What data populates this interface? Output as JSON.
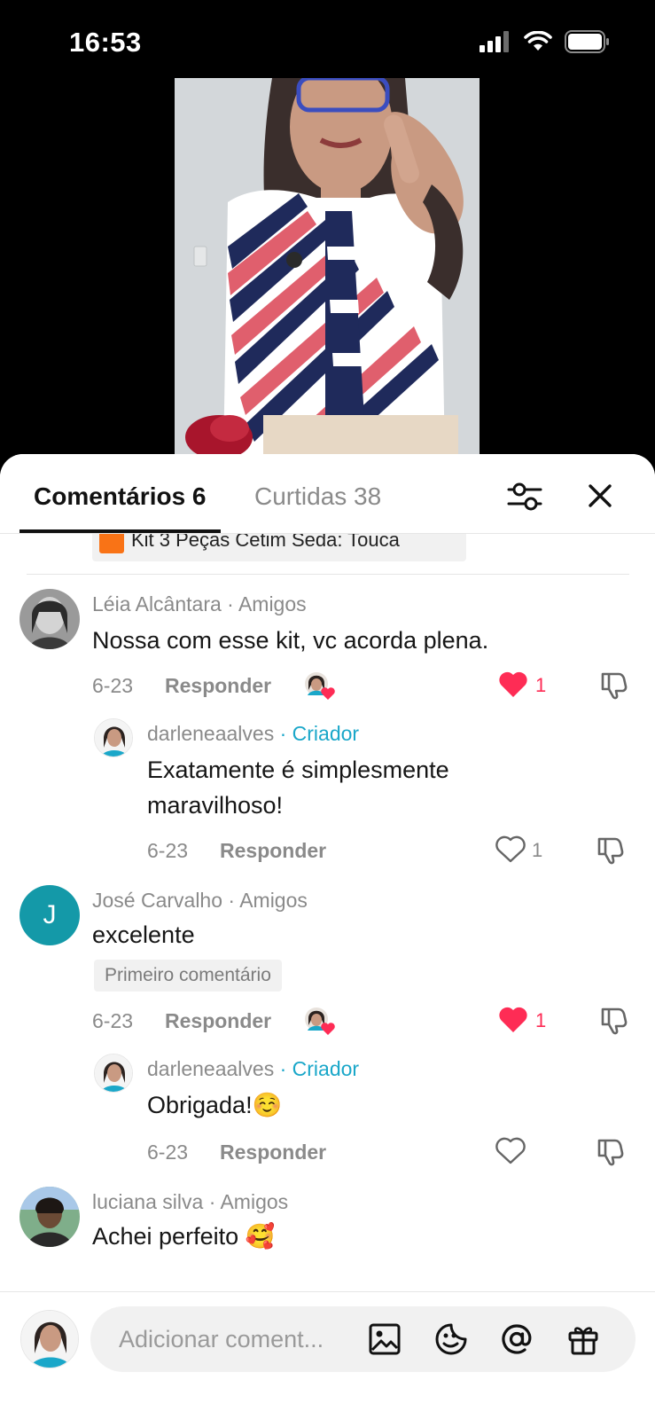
{
  "status_bar": {
    "time": "16:53"
  },
  "tabs": {
    "comments_label": "Comentários 6",
    "likes_label": "Curtidas 38"
  },
  "pinned_preview": {
    "text": "Kit 3 Peças Cetim Seda: Touca"
  },
  "comments": [
    {
      "author": "Léia Alcântara",
      "relation": "· Amigos",
      "text": "Nossa com esse kit, vc acorda plena.",
      "date": "6-23",
      "reply_label": "Responder",
      "likes": "1",
      "liked": true,
      "reply": {
        "author": "darleneaalves",
        "relation": "· Criador",
        "text": "Exatamente é simplesmente maravilhoso!",
        "date": "6-23",
        "reply_label": "Responder",
        "likes": "1",
        "liked": false
      }
    },
    {
      "author": "José Carvalho",
      "relation": "· Amigos",
      "avatar_initial": "J",
      "avatar_color": "#1499a8",
      "text": "excelente",
      "badge": "Primeiro comentário",
      "date": "6-23",
      "reply_label": "Responder",
      "likes": "1",
      "liked": true,
      "reply": {
        "author": "darleneaalves",
        "relation": "· Criador",
        "text": "Obrigada!☺️",
        "date": "6-23",
        "reply_label": "Responder",
        "likes": "",
        "liked": false
      }
    },
    {
      "author": "luciana silva",
      "relation": "· Amigos",
      "text": "Achei perfeito 🥰"
    }
  ],
  "composer": {
    "placeholder": "Adicionar coment..."
  },
  "colors": {
    "like_red": "#fe2c55",
    "creator_blue": "#1aa7c9"
  }
}
